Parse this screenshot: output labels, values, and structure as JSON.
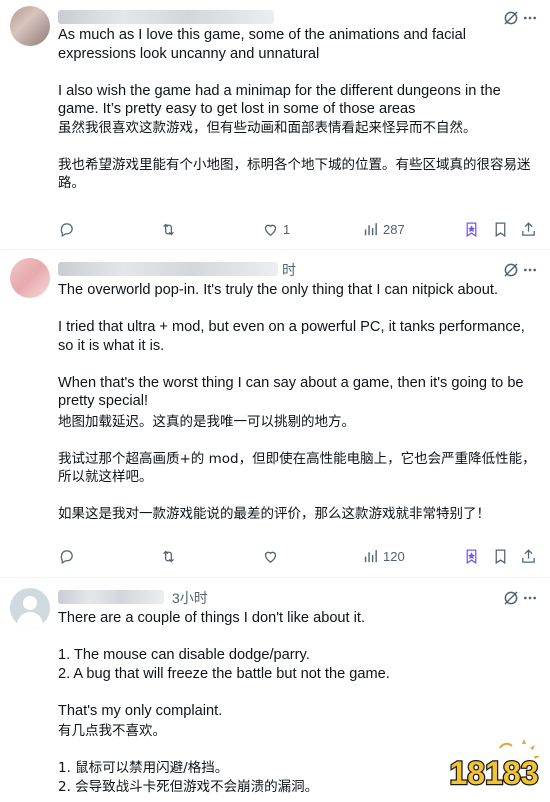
{
  "posts": [
    {
      "time": "",
      "paragraphs_en": [
        "As much as I love this game, some of the animations and facial expressions look uncanny and unnatural",
        "I also wish the game had a minimap for the different dungeons in the game. It’s pretty easy to get lost in some of those areas"
      ],
      "paragraphs_cn": [
        "虽然我很喜欢这款游戏，但有些动画和面部表情看起来怪异而不自然。",
        "我也希望游戏里能有个小地图，标明各个地下城的位置。有些区域真的很容易迷路。"
      ],
      "likes": "1",
      "views": "287"
    },
    {
      "time": "时",
      "paragraphs_en": [
        "The overworld pop-in.  It's truly the only thing that I can nitpick about.",
        "I tried that ultra + mod, but even on a powerful PC, it tanks performance, so it is what it is.",
        "When that's the worst thing I can say about a game, then it's going to be pretty special!"
      ],
      "paragraphs_cn": [
        "地图加载延迟。这真的是我唯一可以挑剔的地方。",
        "我试过那个超高画质+的 mod，但即使在高性能电脑上，它也会严重降低性能，所以就这样吧。",
        "如果这是我对一款游戏能说的最差的评价，那么这款游戏就非常特别了！"
      ],
      "likes": "",
      "views": "120"
    },
    {
      "time": "3小时",
      "paragraphs_en": [
        "There are a couple of things I don't like about it.",
        "1. The mouse can disable dodge/parry.",
        "2. A bug that will freeze the battle but not the game.",
        "That's my only complaint."
      ],
      "paragraphs_cn": [
        "有几点我不喜欢。",
        "1. 鼠标可以禁用闪避/格挡。",
        "2. 会导致战斗卡死但游戏不会崩溃的漏洞。"
      ]
    }
  ],
  "icons": {
    "reply": "reply-icon",
    "retweet": "retweet-icon",
    "like": "heart-icon",
    "views": "views-icon",
    "grok": "grok-icon",
    "bookmark": "bookmark-icon",
    "share": "share-icon"
  },
  "colors": {
    "accent_purple": "#7856ff",
    "secondary_text": "#536471",
    "divider": "#eff3f4"
  },
  "watermark": {
    "text": "18183"
  }
}
